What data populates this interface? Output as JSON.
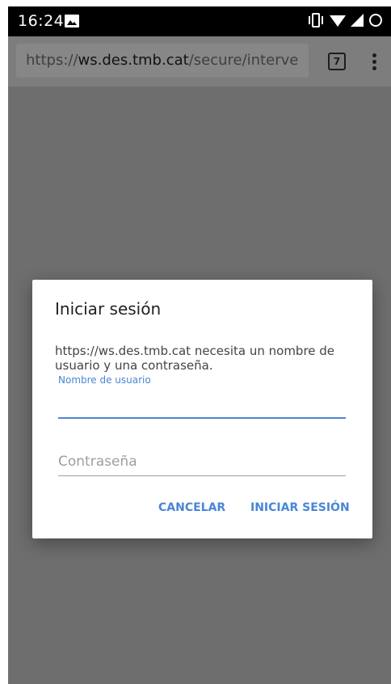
{
  "status_bar": {
    "time": "16:24",
    "icons": [
      "gallery-icon",
      "vibrate-icon",
      "wifi-icon",
      "signal-icon",
      "battery-icon"
    ]
  },
  "toolbar": {
    "url_scheme": "https://",
    "url_host": "ws.des.tmb.cat",
    "url_path": "/secure/interve",
    "tab_count": "7",
    "menu_icon": "overflow-menu-icon"
  },
  "dialog": {
    "title": "Iniciar sesión",
    "message": "https://ws.des.tmb.cat necesita un nombre de usuario y una contraseña.",
    "username_label": "Nombre de usuario",
    "username_value": "",
    "password_placeholder": "Contraseña",
    "cancel_label": "CANCELAR",
    "login_label": "INICIAR SESIÓN"
  },
  "colors": {
    "accent": "#4a86d4",
    "scrim": "#6e6e6e",
    "status_bar": "#000000"
  }
}
